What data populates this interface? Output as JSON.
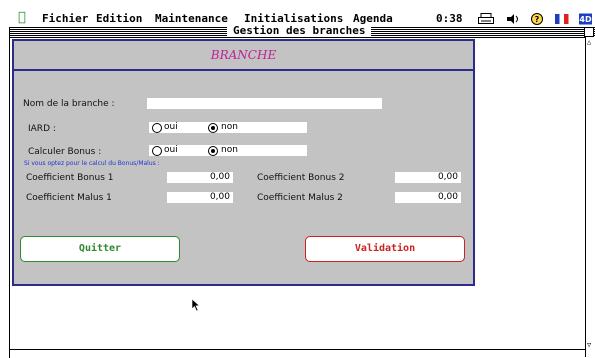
{
  "menubar": {
    "items": [
      "Fichier",
      "Edition",
      "Maintenance",
      "Initialisations",
      "Agenda"
    ],
    "clock": "0:38",
    "icons": [
      "apple-icon",
      "printer-icon",
      "sound-icon",
      "help-icon",
      "flag-icon",
      "app-icon"
    ]
  },
  "window": {
    "title": "Gestion des branches"
  },
  "form": {
    "header": "BRANCHE",
    "nom_label": "Nom de la branche :",
    "nom_value": "",
    "iard_label": "IARD :",
    "iard_options": [
      "oui",
      "non"
    ],
    "iard_selected": "non",
    "bonus_label": "Calculer Bonus :",
    "bonus_options": [
      "oui",
      "non"
    ],
    "bonus_selected": "non",
    "note": "Si vous optez pour le calcul du Bonus/Malus :",
    "coef_bonus1_label": "Coefficient Bonus 1",
    "coef_bonus1_value": "0,00",
    "coef_bonus2_label": "Coefficient Bonus 2",
    "coef_bonus2_value": "0,00",
    "coef_malus1_label": "Coefficient Malus 1",
    "coef_malus1_value": "0,00",
    "coef_malus2_label": "Coefficient Malus 2",
    "coef_malus2_value": "0,00",
    "quit_label": "Quitter",
    "valid_label": "Validation"
  },
  "colors": {
    "accent_green": "#2e8b2e",
    "accent_red": "#cc2222",
    "header_text": "#c0209a",
    "border_blue": "#2b2b8c",
    "form_bg": "#c3c3c3"
  }
}
